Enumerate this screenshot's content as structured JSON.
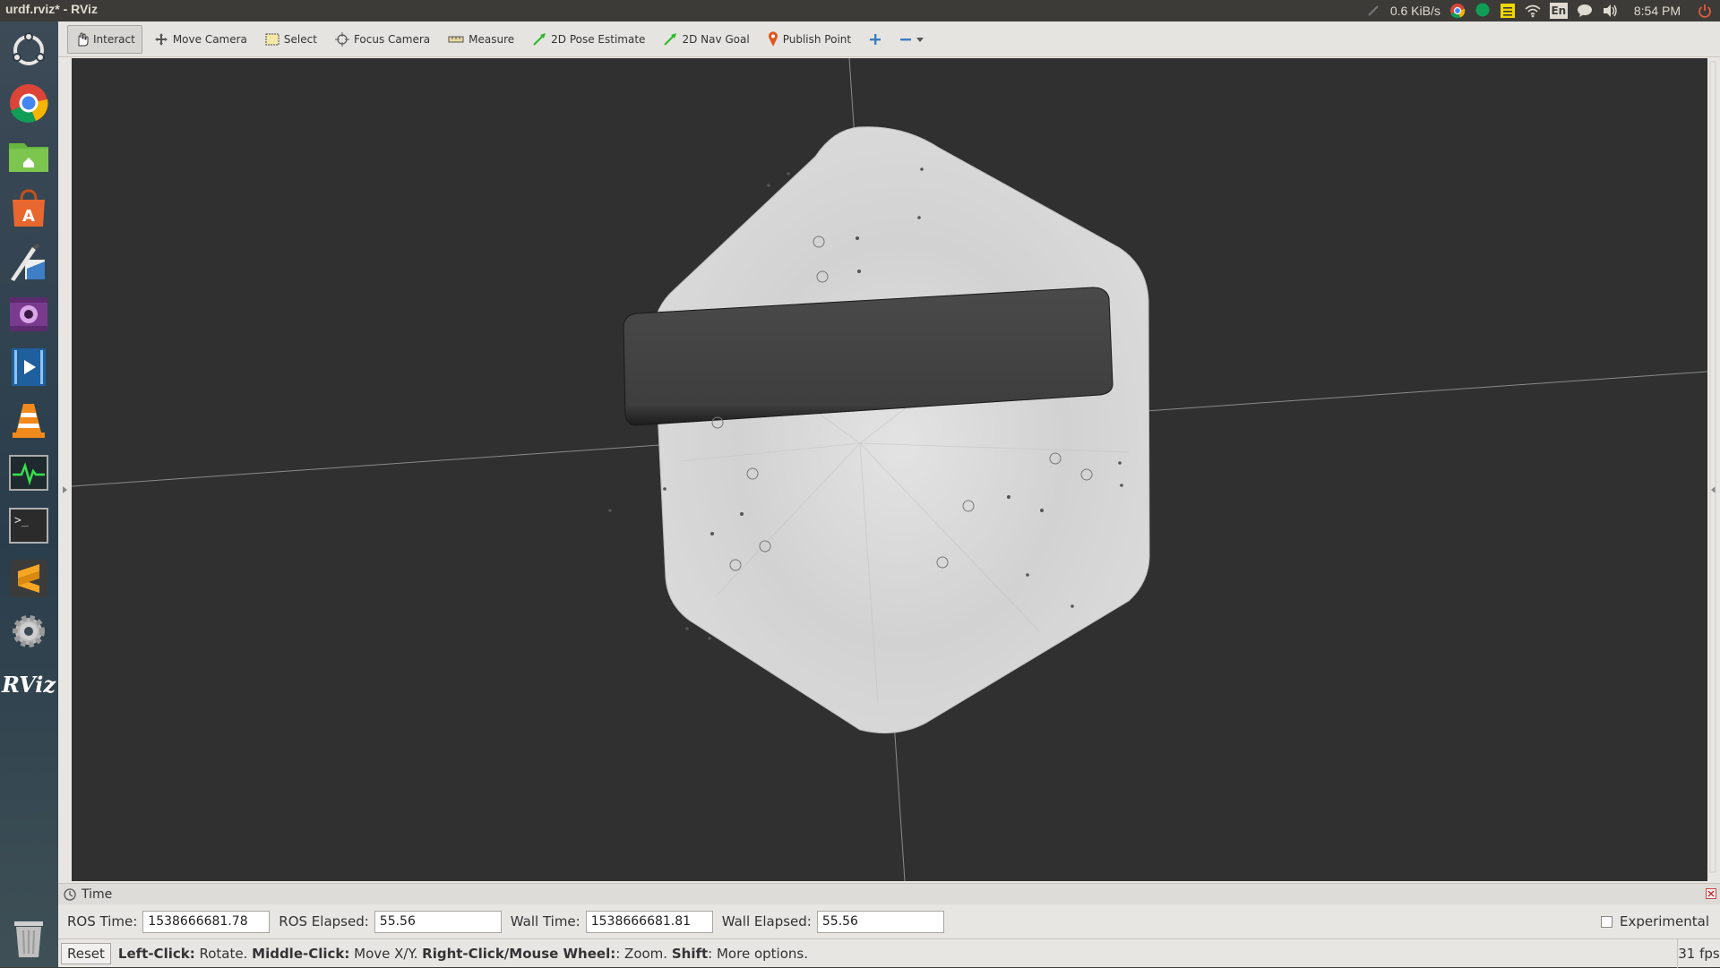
{
  "topbar": {
    "window_title": "urdf.rviz* - RViz",
    "net_speed": "0.6 KiB/s",
    "keyboard_layout": "En",
    "clock": "8:54 PM",
    "tray_icons": [
      "sync-icon",
      "chrome-icon",
      "hangouts-icon",
      "notes-icon",
      "wifi-icon",
      "keyboard-icon",
      "messaging-icon",
      "volume-icon",
      "power-icon"
    ]
  },
  "launcher": {
    "items": [
      "ubuntu-dash-icon",
      "chrome-icon",
      "files-icon",
      "software-center-icon",
      "libreoffice-draw-icon",
      "webcam-icon",
      "video-editor-icon",
      "vlc-icon",
      "system-monitor-icon",
      "terminal-icon",
      "sublime-text-icon",
      "system-settings-icon",
      "rviz-icon",
      "trash-icon"
    ],
    "rviz_label": "RViz"
  },
  "toolbar": {
    "tools": [
      {
        "label": "Interact",
        "icon": "hand-icon",
        "active": true
      },
      {
        "label": "Move Camera",
        "icon": "move-camera-icon",
        "active": false
      },
      {
        "label": "Select",
        "icon": "select-icon",
        "active": false
      },
      {
        "label": "Focus Camera",
        "icon": "focus-icon",
        "active": false
      },
      {
        "label": "Measure",
        "icon": "ruler-icon",
        "active": false
      },
      {
        "label": "2D Pose Estimate",
        "icon": "green-arrow-icon",
        "active": false
      },
      {
        "label": "2D Nav Goal",
        "icon": "green-arrow-icon",
        "active": false
      },
      {
        "label": "Publish Point",
        "icon": "pin-icon",
        "active": false
      }
    ],
    "add_icon": "plus-icon",
    "remove_icon": "minus-icon"
  },
  "time_panel": {
    "title": "Time",
    "ros_time_label": "ROS Time:",
    "ros_time": "1538666681.78",
    "ros_elapsed_label": "ROS Elapsed:",
    "ros_elapsed": "55.56",
    "wall_time_label": "Wall Time:",
    "wall_time": "1538666681.81",
    "wall_elapsed_label": "Wall Elapsed:",
    "wall_elapsed": "55.56",
    "experimental_label": "Experimental",
    "experimental_checked": false
  },
  "statusbar": {
    "reset_label": "Reset",
    "hint_parts": [
      {
        "text": "Left-Click:",
        "bold": true
      },
      {
        "text": " Rotate. ",
        "bold": false
      },
      {
        "text": "Middle-Click:",
        "bold": true
      },
      {
        "text": " Move X/Y. ",
        "bold": false
      },
      {
        "text": "Right-Click/Mouse Wheel:",
        "bold": true
      },
      {
        "text": ": Zoom. ",
        "bold": false
      },
      {
        "text": "Shift",
        "bold": true
      },
      {
        "text": ": More options.",
        "bold": false
      }
    ],
    "fps": "31 fps"
  },
  "colors": {
    "viewport_bg": "#303030",
    "plate": "#d4d4d4",
    "bar": "#3f3f3f",
    "axis_line": "#8a8a8a"
  }
}
